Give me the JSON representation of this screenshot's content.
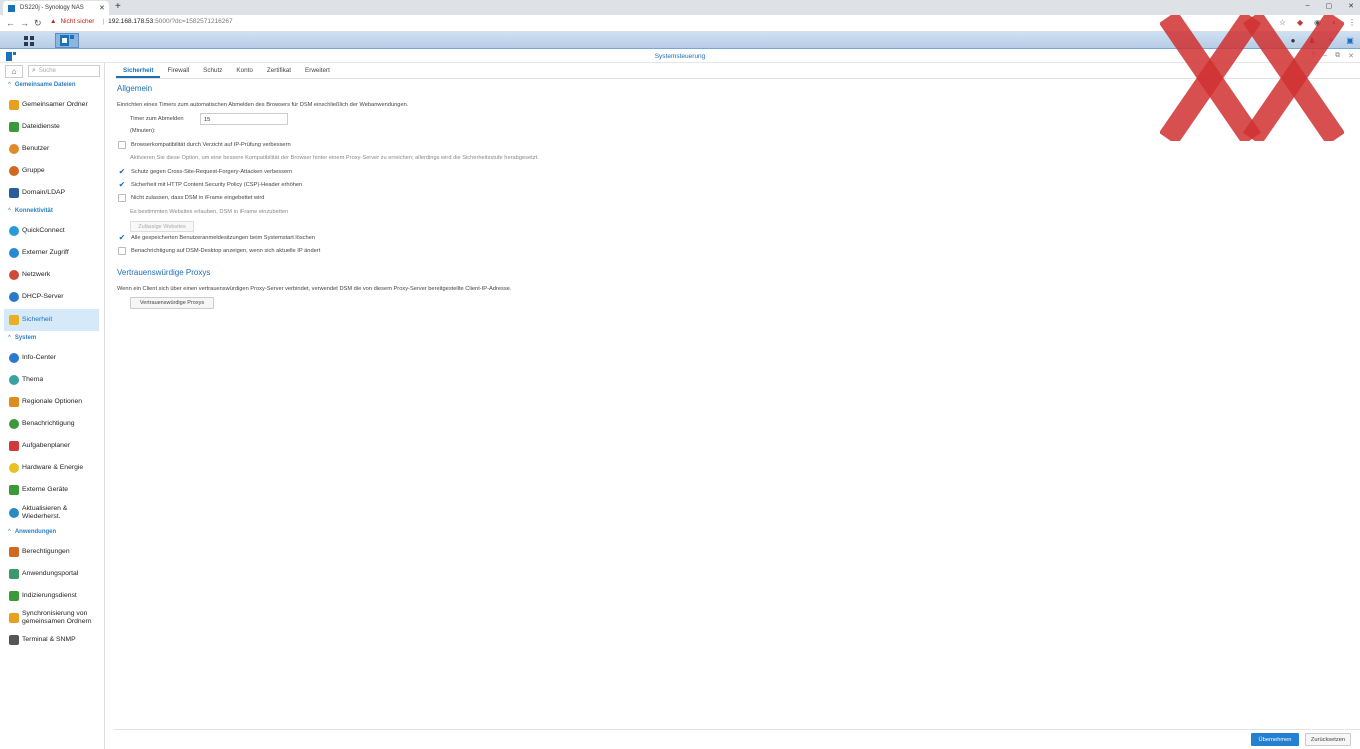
{
  "browser": {
    "tab_title": "DS220j - Synology NAS",
    "tab_close": "✕",
    "new_tab": "+",
    "window_controls": [
      "–",
      "▢",
      "✕"
    ],
    "security_warning": "Nicht sicher",
    "url_host": "192.168.178.53",
    "url_path": ":5000/?dc=1582571216267"
  },
  "window": {
    "title": "Systemsteuerung"
  },
  "sidebar": {
    "search_placeholder": "Suche",
    "sections": [
      {
        "label": "Gemeinsame Dateien",
        "items": [
          {
            "label": "Gemeinsamer Ordner",
            "color": "#e8a020"
          },
          {
            "label": "Dateidienste",
            "color": "#3a9a3a"
          },
          {
            "label": "Benutzer",
            "color": "#e08a30"
          },
          {
            "label": "Gruppe",
            "color": "#d06a20"
          },
          {
            "label": "Domain/LDAP",
            "color": "#2a5e9a"
          }
        ]
      },
      {
        "label": "Konnektivität",
        "items": [
          {
            "label": "QuickConnect",
            "color": "#2a9ad6"
          },
          {
            "label": "Externer Zugriff",
            "color": "#2a8ad0"
          },
          {
            "label": "Netzwerk",
            "color": "#d04a3a"
          },
          {
            "label": "DHCP-Server",
            "color": "#2a7ac8"
          },
          {
            "label": "Sicherheit",
            "color": "#e8b020",
            "active": true
          }
        ]
      },
      {
        "label": "System",
        "items": [
          {
            "label": "Info-Center",
            "color": "#2a7ad0"
          },
          {
            "label": "Thema",
            "color": "#3aa0a0"
          },
          {
            "label": "Regionale Optionen",
            "color": "#e08a20"
          },
          {
            "label": "Benachrichtigung",
            "color": "#3a9a3a"
          },
          {
            "label": "Aufgabenplaner",
            "color": "#d03a3a"
          },
          {
            "label": "Hardware & Energie",
            "color": "#e8c020"
          },
          {
            "label": "Externe Geräte",
            "color": "#3a9a3a"
          },
          {
            "label": "Aktualisieren & Wiederherst.",
            "color": "#2a8ac0"
          }
        ]
      },
      {
        "label": "Anwendungen",
        "items": [
          {
            "label": "Berechtigungen",
            "color": "#d06a20"
          },
          {
            "label": "Anwendungsportal",
            "color": "#3a9a6a"
          },
          {
            "label": "Indizierungsdienst",
            "color": "#3a9a3a"
          },
          {
            "label": "Synchronisierung von gemeinsamen Ordnern",
            "color": "#e8a020"
          },
          {
            "label": "Terminal & SNMP",
            "color": "#555555"
          }
        ]
      }
    ]
  },
  "tabs": [
    "Sicherheit",
    "Firewall",
    "Schutz",
    "Konto",
    "Zertifikat",
    "Erweitert"
  ],
  "general": {
    "heading": "Allgemein",
    "logout_desc": "Einrichten eines Timers zum automatischen Abmelden des Browsers für DSM einschließlich der Webanwendungen.",
    "timer_label": "Timer zum Abmelden",
    "timer_unit": "(Minuten):",
    "timer_value": "15",
    "cb_ip_check": "Browserkompatibilität durch Verzicht auf IP-Prüfung verbessern",
    "ip_check_hint": "Aktivieren Sie diese Option, um eine bessere Kompatibilität der Browser hinter einem Proxy-Server zu erreichen; allerdings wird die Sicherheitsstufe herabgesetzt.",
    "cb_csrf": "Schutz gegen Cross-Site-Request-Forgery-Attacken verbessern",
    "cb_csp": "Sicherheit mit HTTP Content Security Policy (CSP)-Header erhöhen",
    "cb_iframe": "Nicht zulassen, dass DSM in iFrame eingebettet wird",
    "iframe_hint": "Es bestimmten Websites erlauben, DSM in iFrame einzubetten",
    "allowed_sites_button": "Zulässige Websites",
    "cb_clear_logins": "Alle gespeicherten Benutzeranmeldesitzungen beim Systemstart löschen",
    "cb_notify_ip": "Benachrichtigung auf DSM-Desktop anzeigen, wenn sich aktuelle IP ändert"
  },
  "proxies": {
    "heading": "Vertrauenswürdige Proxys",
    "desc": "Wenn ein Client sich über einen vertrauenswürdigen Proxy-Server verbindet, verwendet DSM die von diesem Proxy-Server bereitgestellte Client-IP-Adresse.",
    "button": "Vertrauenswürdige Proxys"
  },
  "footer": {
    "apply": "Übernehmen",
    "reset": "Zurücksetzen"
  },
  "colors": {
    "accent": "#1a6fb6",
    "apply_button": "#2580d0",
    "watermark": "#d03030"
  }
}
